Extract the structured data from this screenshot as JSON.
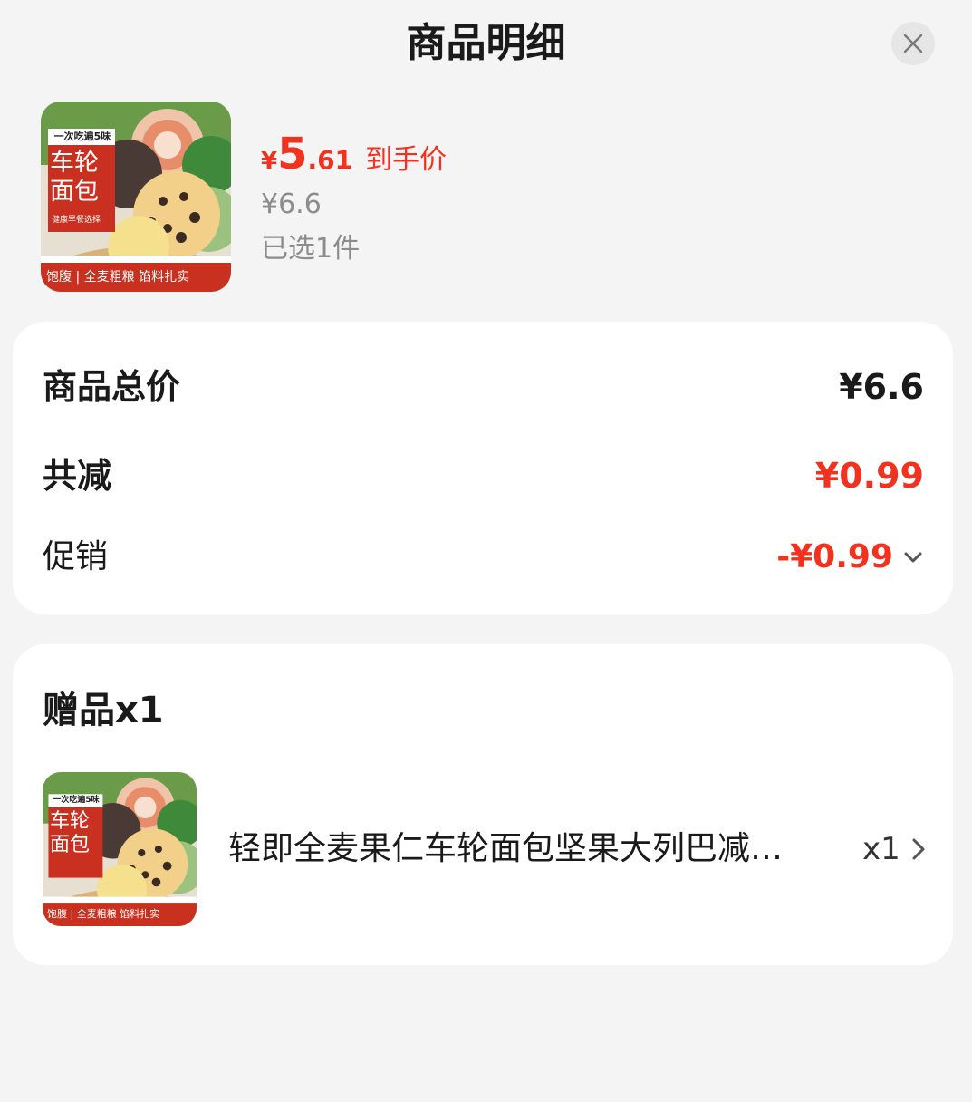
{
  "header": {
    "title": "商品明细",
    "close_icon": "close-icon"
  },
  "product": {
    "image_label": "product-thumbnail",
    "image_text": {
      "top_banner": "一次吃遍5味",
      "name_line1": "车轮",
      "name_line2": "面包",
      "check_label": "健康早餐选择",
      "bottom_bar": "饱腹 | 全麦粗粮 馅料扎实"
    },
    "currency_symbol": "¥",
    "final_price_int": "5",
    "final_price_dec": ".61",
    "final_price_tag": "到手价",
    "original_price": "¥6.6",
    "selected_count": "已选1件"
  },
  "summary": {
    "total_label": "商品总价",
    "total_value": "¥6.6",
    "discount_label": "共减",
    "discount_value": "¥0.99",
    "promo_label": "促销",
    "promo_value": "-¥0.99",
    "promo_icon": "chevron-down-icon"
  },
  "gift": {
    "title": "赠品x1",
    "item_name": "轻即全麦果仁车轮面包坚果大列巴减…",
    "item_qty": "x1",
    "item_icon": "chevron-right-icon"
  },
  "colors": {
    "accent_red": "#f2321e",
    "muted_gray": "#8c8c8c",
    "background": "#f4f4f4",
    "card": "#ffffff"
  }
}
